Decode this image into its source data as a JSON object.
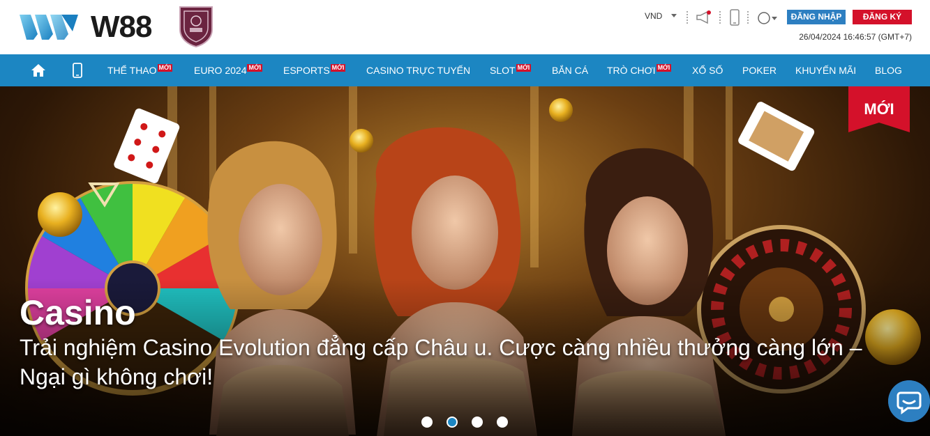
{
  "header": {
    "brand": "W88",
    "currency": "VND",
    "login_label": "ĐĂNG NHẬP",
    "register_label": "ĐĂNG KÝ",
    "datetime": "26/04/2024 16:46:57 (GMT+7)"
  },
  "nav": {
    "items": [
      {
        "label": "THỂ THAO",
        "badge": "MỚI"
      },
      {
        "label": "EURO 2024",
        "badge": "MỚI"
      },
      {
        "label": "ESPORTS",
        "badge": "MỚI"
      },
      {
        "label": "CASINO TRỰC TUYẾN",
        "badge": ""
      },
      {
        "label": "SLOT",
        "badge": "MỚI"
      },
      {
        "label": "BẮN CÁ",
        "badge": ""
      },
      {
        "label": "TRÒ CHƠI",
        "badge": "MỚI"
      },
      {
        "label": "XỔ SỐ",
        "badge": ""
      },
      {
        "label": "POKER",
        "badge": ""
      },
      {
        "label": "KHUYẾN MÃI",
        "badge": ""
      },
      {
        "label": "BLOG",
        "badge": ""
      }
    ]
  },
  "hero": {
    "badge": "MỚI",
    "title": "Casino",
    "subtitle": "Trải nghiệm Casino Evolution đẳng cấp Châu u. Cược càng nhiều thưởng càng lớn – Ngại gì không chơi!",
    "slides_total": 4,
    "active_slide": 2
  },
  "colors": {
    "nav_bg": "#1c86c2",
    "login_bg": "#2d7fc1",
    "register_bg": "#d4112a",
    "badge_red": "#d4112a"
  },
  "icons": {
    "home": "home-icon",
    "mobile": "mobile-icon",
    "megaphone": "megaphone-icon",
    "phone": "phone-icon",
    "language": "globe-icon",
    "chat": "chat-icon"
  }
}
